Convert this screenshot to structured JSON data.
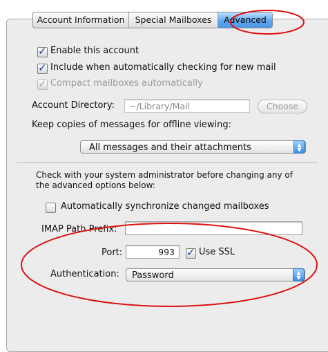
{
  "tabs": [
    {
      "label": "Account Information",
      "selected": false
    },
    {
      "label": "Special Mailboxes",
      "selected": false
    },
    {
      "label": "Advanced",
      "selected": true
    }
  ],
  "options": {
    "enable_account": {
      "label": "Enable this account",
      "checked": true
    },
    "include_check": {
      "label": "Include when automatically checking for new mail",
      "checked": true
    },
    "compact": {
      "label": "Compact mailboxes automatically",
      "checked": true,
      "disabled": true
    }
  },
  "account_directory": {
    "label": "Account Directory:",
    "value": "~/Library/Mail",
    "choose_label": "Choose"
  },
  "offline": {
    "label": "Keep copies of messages for offline viewing:",
    "selected": "All messages and their attachments"
  },
  "notice": {
    "line1": "Check with your system administrator before changing any of",
    "line2": "the advanced options below:"
  },
  "sync": {
    "label": "Automatically synchronize changed mailboxes",
    "checked": false
  },
  "imap": {
    "label": "IMAP Path Prefix:",
    "value": ""
  },
  "port": {
    "label": "Port:",
    "value": "993"
  },
  "ssl": {
    "label": "Use SSL",
    "checked": true
  },
  "auth": {
    "label": "Authentication:",
    "selected": "Password"
  },
  "colors": {
    "highlight": "#dd1111",
    "tab_selected": "#5ea8ef"
  }
}
